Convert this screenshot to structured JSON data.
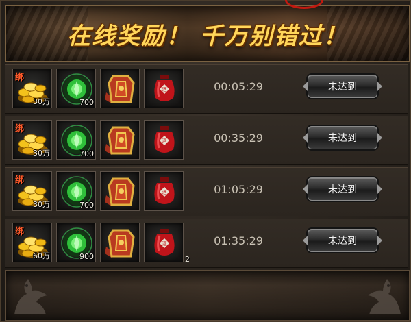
{
  "banner": {
    "title": "在线奖励！ 千万别错过！"
  },
  "rewards": [
    {
      "gold": {
        "bind_tag": "绑",
        "qty": "30万"
      },
      "jade": {
        "qty": "700"
      },
      "armor": {},
      "jar": {
        "qty": ""
      },
      "time": "00:05:29",
      "button_label": "未达到"
    },
    {
      "gold": {
        "bind_tag": "绑",
        "qty": "30万"
      },
      "jade": {
        "qty": "700"
      },
      "armor": {},
      "jar": {
        "qty": ""
      },
      "time": "00:35:29",
      "button_label": "未达到"
    },
    {
      "gold": {
        "bind_tag": "绑",
        "qty": "30万"
      },
      "jade": {
        "qty": "700"
      },
      "armor": {},
      "jar": {
        "qty": ""
      },
      "time": "01:05:29",
      "button_label": "未达到"
    },
    {
      "gold": {
        "bind_tag": "绑",
        "qty": "60万"
      },
      "jade": {
        "qty": "900"
      },
      "armor": {},
      "jar": {
        "qty": "2"
      },
      "time": "01:35:29",
      "button_label": "未达到"
    }
  ],
  "icons": {
    "gold": "gold-ingots-icon",
    "jade": "green-jade-icon",
    "armor": "armor-vest-icon",
    "jar": "red-jar-icon"
  },
  "colors": {
    "title": "#ffd65a",
    "bind_tag": "#ff5a2a",
    "time": "#c9c2b4"
  }
}
